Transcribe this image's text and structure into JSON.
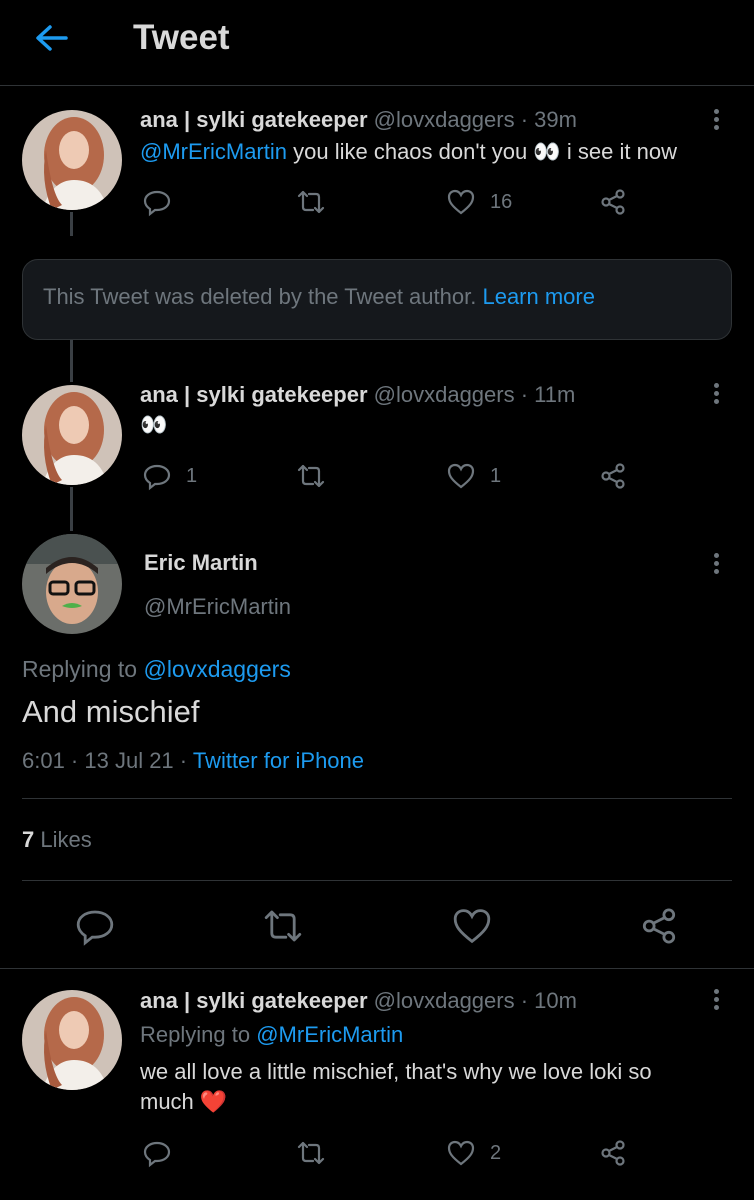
{
  "header": {
    "title": "Tweet"
  },
  "tweet1": {
    "name": "ana | sylki gatekeeper",
    "handle": "@lovxdaggers",
    "time": "· 39m",
    "mention": "@MrEricMartin",
    "text": "you like chaos don't you",
    "emoji": "👀",
    "text2": "i see it now",
    "likes": "16"
  },
  "deleted": {
    "text": "This Tweet was deleted by the Tweet author.",
    "link": "Learn more"
  },
  "tweet2": {
    "name": "ana | sylki gatekeeper",
    "handle": "@lovxdaggers",
    "time": "· 11m",
    "text": "👀",
    "replies": "1",
    "likes": "1"
  },
  "main": {
    "name": "Eric Martin",
    "handle": "@MrEricMartin",
    "replying_prefix": "Replying to",
    "replying_to": "@lovxdaggers",
    "text": "And mischief",
    "date": "6:01 · 13 Jul 21 ·",
    "source": "Twitter for iPhone",
    "likes_count": "7",
    "likes_label": "Likes"
  },
  "tweet3": {
    "name": "ana | sylki gatekeeper",
    "handle": "@lovxdaggers",
    "time": "· 10m",
    "replying_prefix": "Replying to",
    "replying_to": "@MrEricMartin",
    "text_line1": "we all love a little mischief, that's why we love loki so",
    "text_line2": "much",
    "heart": "❤️",
    "likes": "2"
  },
  "colors": {
    "accent": "#1d9bf0",
    "muted": "#6e767d",
    "background": "#000000"
  }
}
